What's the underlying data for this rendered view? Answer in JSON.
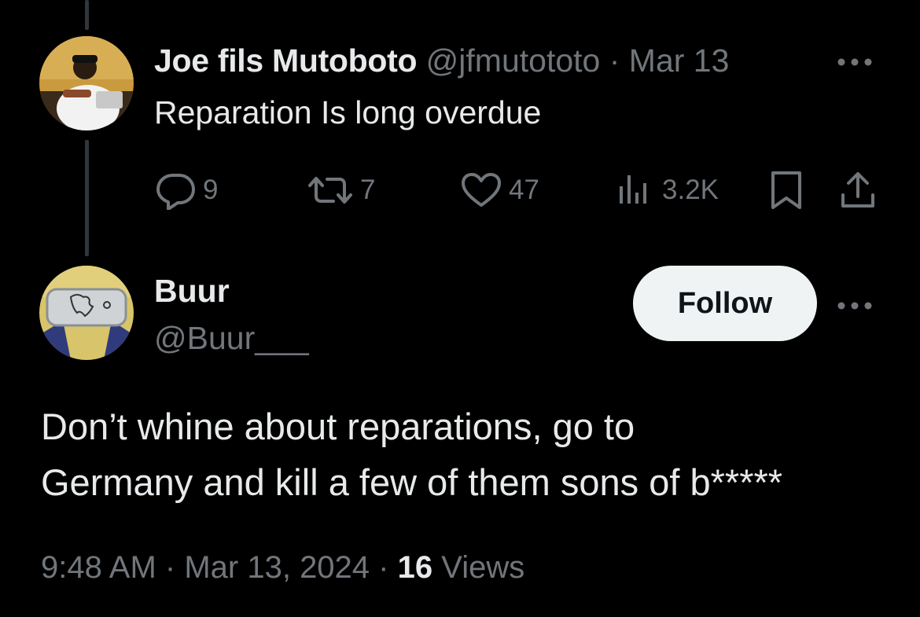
{
  "parent_tweet": {
    "display_name": "Joe fils Mutoboto",
    "handle": "@jfmutototo",
    "separator": "·",
    "date": "Mar 13",
    "text": "Reparation Is long overdue",
    "more_icon": "more-horizontal-icon",
    "actions": {
      "replies": "9",
      "retweets": "7",
      "likes": "47",
      "views": "3.2K"
    }
  },
  "reply_tweet": {
    "display_name": "Buur",
    "handle": "@Buur___",
    "follow_label": "Follow",
    "text_lines": [
      "Don’t whine about reparations, go to",
      "Germany and kill a few of them sons of b*****"
    ],
    "time": "9:48 AM",
    "separator": "·",
    "date": "Mar 13, 2024",
    "separator2": "·",
    "views_count": "16",
    "views_label": "Views"
  },
  "colors": {
    "background": "#000000",
    "text_primary": "#e7e9ea",
    "text_secondary": "#71767b",
    "follow_bg": "#eff3f4",
    "thread_line": "#333639"
  }
}
